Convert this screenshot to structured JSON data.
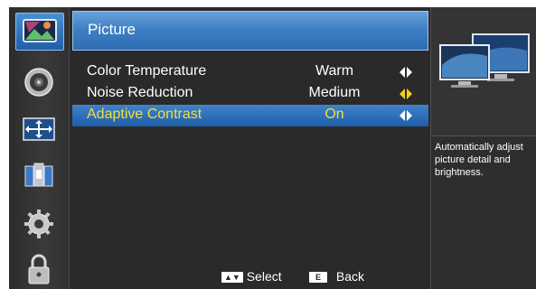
{
  "menu": {
    "title": "Picture",
    "items": [
      {
        "label": "Color Temperature",
        "value": "Warm",
        "arrow_color": "#ffffff"
      },
      {
        "label": "Noise Reduction",
        "value": "Medium",
        "arrow_color": "#f5d21a"
      },
      {
        "label": "Adaptive Contrast",
        "value": "On",
        "arrow_color": "#ffffff",
        "selected": true
      }
    ]
  },
  "sidebar": {
    "icons": [
      "picture-icon",
      "sound-icon",
      "screen-icon",
      "channel-icon",
      "settings-icon",
      "lock-icon"
    ],
    "selected": "picture-icon"
  },
  "info": {
    "description": "Automatically adjust picture detail and brightness."
  },
  "footer": {
    "select_key": "▲▼",
    "select_label": "Select",
    "back_key": "E",
    "back_label": "Back"
  },
  "colors": {
    "accent": "#3f7fc4",
    "selected_text": "#f3e03a"
  }
}
